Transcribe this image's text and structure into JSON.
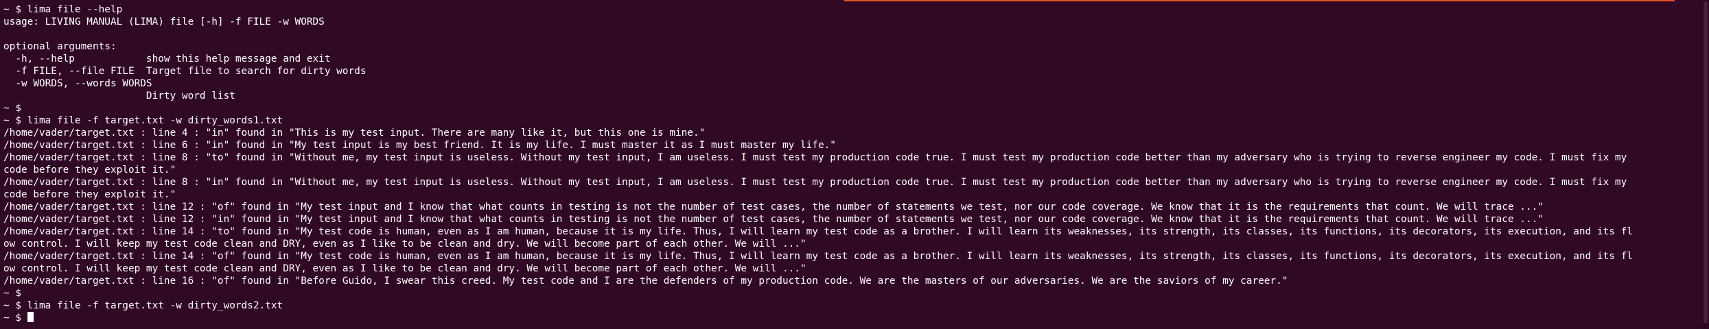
{
  "terminal": {
    "lines": [
      "~ $ lima file --help",
      "usage: LIVING MANUAL (LIMA) file [-h] -f FILE -w WORDS",
      "",
      "optional arguments:",
      "  -h, --help            show this help message and exit",
      "  -f FILE, --file FILE  Target file to search for dirty words",
      "  -w WORDS, --words WORDS",
      "                        Dirty word list",
      "~ $",
      "~ $ lima file -f target.txt -w dirty_words1.txt",
      "/home/vader/target.txt : line 4 : \"in\" found in \"This is my test input. There are many like it, but this one is mine.\"",
      "/home/vader/target.txt : line 6 : \"in\" found in \"My test input is my best friend. It is my life. I must master it as I must master my life.\"",
      "/home/vader/target.txt : line 8 : \"to\" found in \"Without me, my test input is useless. Without my test input, I am useless. I must test my production code true. I must test my production code better than my adversary who is trying to reverse engineer my code. I must fix my",
      "code before they exploit it.\"",
      "/home/vader/target.txt : line 8 : \"in\" found in \"Without me, my test input is useless. Without my test input, I am useless. I must test my production code true. I must test my production code better than my adversary who is trying to reverse engineer my code. I must fix my",
      "code before they exploit it.\"",
      "/home/vader/target.txt : line 12 : \"of\" found in \"My test input and I know that what counts in testing is not the number of test cases, the number of statements we test, nor our code coverage. We know that it is the requirements that count. We will trace ...\"",
      "/home/vader/target.txt : line 12 : \"in\" found in \"My test input and I know that what counts in testing is not the number of test cases, the number of statements we test, nor our code coverage. We know that it is the requirements that count. We will trace ...\"",
      "/home/vader/target.txt : line 14 : \"to\" found in \"My test code is human, even as I am human, because it is my life. Thus, I will learn my test code as a brother. I will learn its weaknesses, its strength, its classes, its functions, its decorators, its execution, and its fl",
      "ow control. I will keep my test code clean and DRY, even as I like to be clean and dry. We will become part of each other. We will ...\"",
      "/home/vader/target.txt : line 14 : \"of\" found in \"My test code is human, even as I am human, because it is my life. Thus, I will learn my test code as a brother. I will learn its weaknesses, its strength, its classes, its functions, its decorators, its execution, and its fl",
      "ow control. I will keep my test code clean and DRY, even as I like to be clean and dry. We will become part of each other. We will ...\"",
      "/home/vader/target.txt : line 16 : \"of\" found in \"Before Guido, I swear this creed. My test code and I are the defenders of my production code. We are the masters of our adversaries. We are the saviors of my career.\"",
      "~ $",
      "~ $ lima file -f target.txt -w dirty_words2.txt"
    ],
    "prompt": "~ $ ",
    "colors": {
      "background": "#300a24",
      "foreground": "#ffffff",
      "accent": "#e95420"
    }
  }
}
